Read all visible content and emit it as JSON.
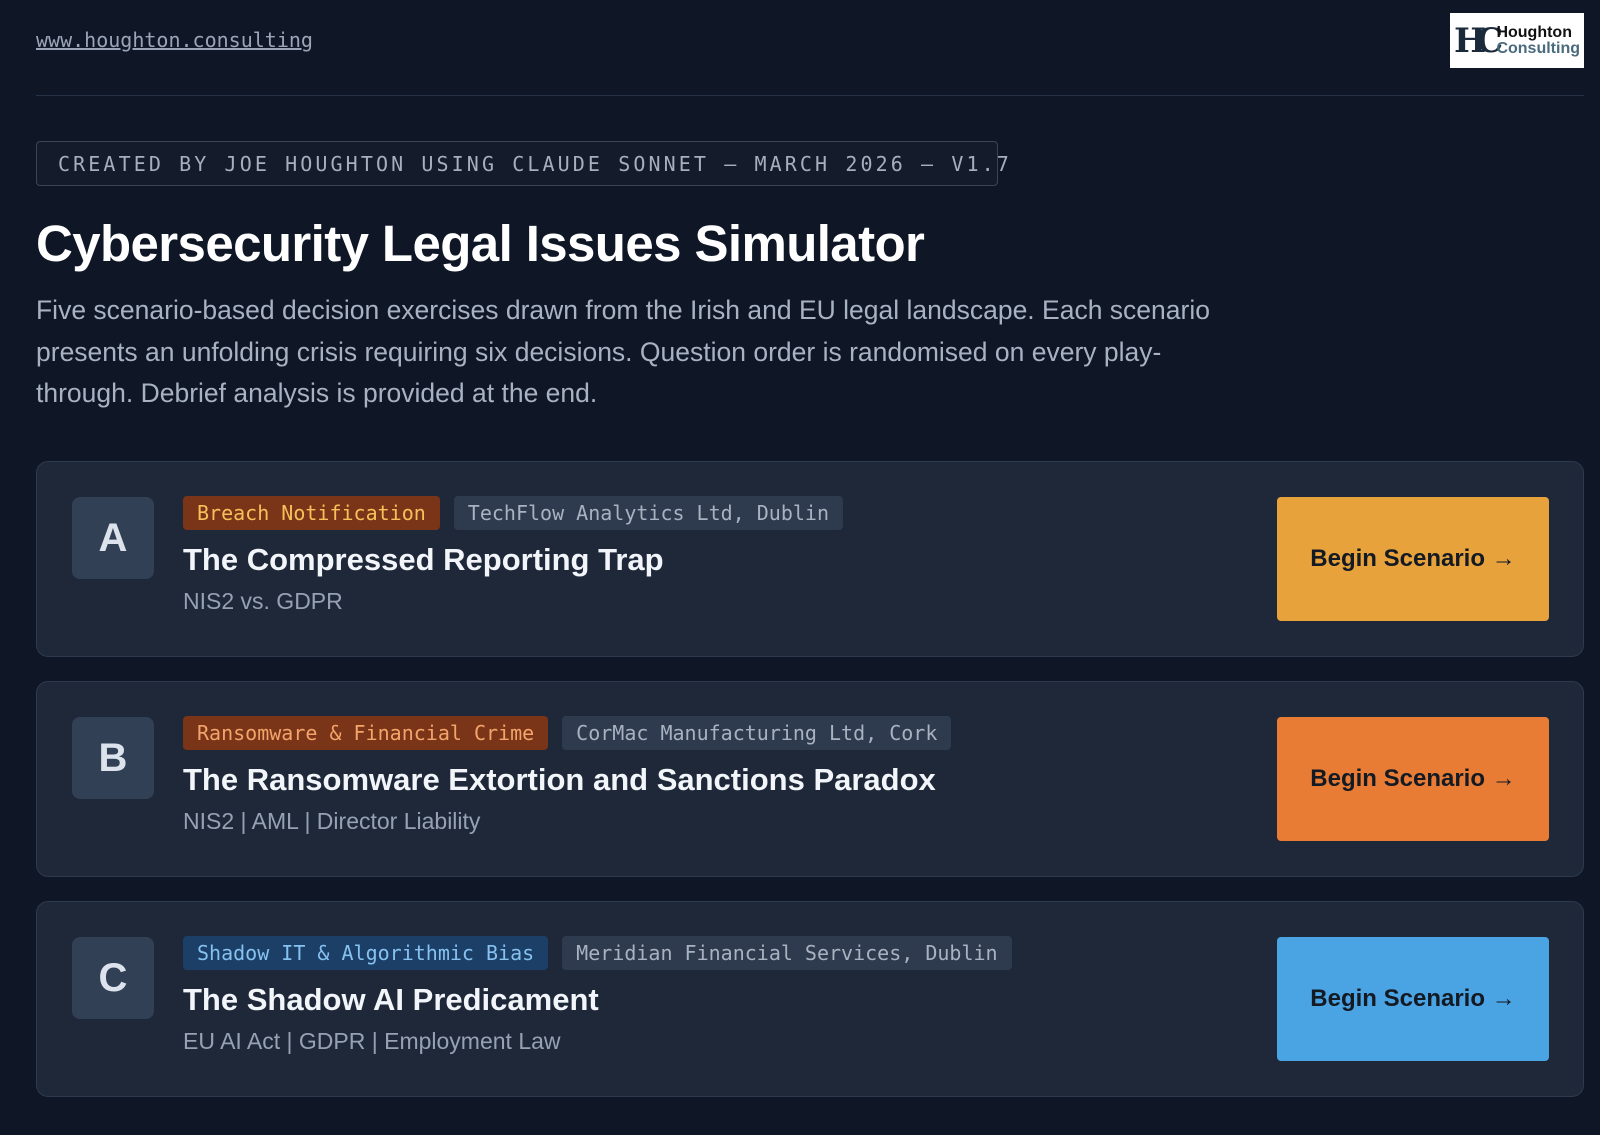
{
  "header": {
    "site_link": "www.houghton.consulting",
    "logo": {
      "mark": "HC",
      "line1": "Houghton",
      "line2": "Consulting"
    }
  },
  "credit": "CREATED BY JOE HOUGHTON USING CLAUDE SONNET — MARCH 2026 — V1.7",
  "title": "Cybersecurity Legal Issues Simulator",
  "intro": "Five scenario-based decision exercises drawn from the Irish and EU legal landscape. Each scenario presents an unfolding crisis requiring six decisions. Question order is randomised on every play-through. Debrief analysis is provided at the end.",
  "scenarios": [
    {
      "letter": "A",
      "category": "Breach Notification",
      "category_bg": "#7a3518",
      "category_fg": "#f6c05a",
      "organisation": "TechFlow Analytics Ltd, Dublin",
      "title": "The Compressed Reporting Trap",
      "subtitle": "NIS2 vs. GDPR",
      "button_label": "Begin Scenario →",
      "button_color": "#e8a23c"
    },
    {
      "letter": "B",
      "category": "Ransomware & Financial Crime",
      "category_bg": "#7a3518",
      "category_fg": "#f3a46a",
      "organisation": "CorMac Manufacturing Ltd, Cork",
      "title": "The Ransomware Extortion and Sanctions Paradox",
      "subtitle": "NIS2 | AML | Director Liability",
      "button_label": "Begin Scenario →",
      "button_color": "#e97c34"
    },
    {
      "letter": "C",
      "category": "Shadow IT & Algorithmic Bias",
      "category_bg": "#1b3f66",
      "category_fg": "#86c1f0",
      "organisation": "Meridian Financial Services, Dublin",
      "title": "The Shadow AI Predicament",
      "subtitle": "EU AI Act | GDPR | Employment Law",
      "button_label": "Begin Scenario →",
      "button_color": "#4aa3e2"
    }
  ]
}
